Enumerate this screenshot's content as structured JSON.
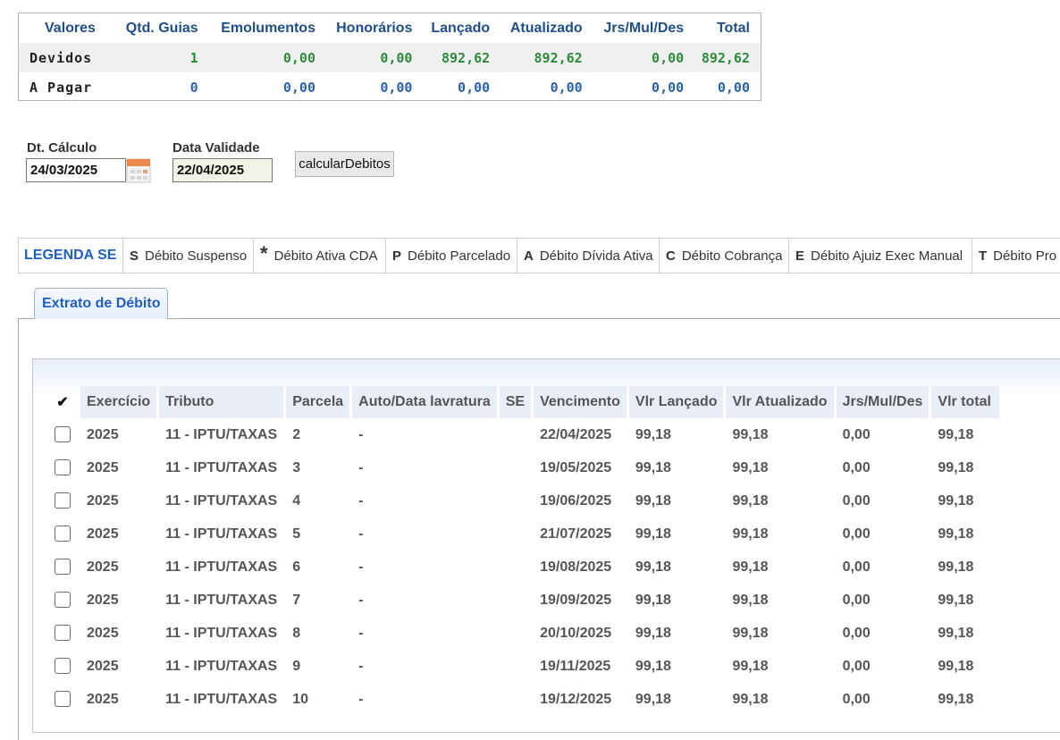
{
  "summary": {
    "headers": [
      "Valores",
      "Qtd. Guias",
      "Emolumentos",
      "Honorários",
      "Lançado",
      "Atualizado",
      "Jrs/Mul/Des",
      "Total"
    ],
    "rows": [
      {
        "label": "Devidos",
        "qtd": "1",
        "emolumentos": "0,00",
        "honorarios": "0,00",
        "lancado": "892,62",
        "atualizado": "892,62",
        "jrs": "0,00",
        "total": "892,62"
      },
      {
        "label": "A Pagar",
        "qtd": "0",
        "emolumentos": "0,00",
        "honorarios": "0,00",
        "lancado": "0,00",
        "atualizado": "0,00",
        "jrs": "0,00",
        "total": "0,00"
      }
    ]
  },
  "form": {
    "dt_calculo_label": "Dt. Cálculo",
    "dt_calculo_value": "24/03/2025",
    "data_validade_label": "Data Validade",
    "data_validade_value": "22/04/2025",
    "calc_button": "calcularDebitos"
  },
  "legend": {
    "title": "LEGENDA SE",
    "items": [
      {
        "code": "S",
        "label": "Débito Suspenso"
      },
      {
        "code": "*",
        "label": "Débito Ativa CDA"
      },
      {
        "code": "P",
        "label": "Débito Parcelado"
      },
      {
        "code": "A",
        "label": "Débito Dívida Ativa"
      },
      {
        "code": "C",
        "label": "Débito Cobrança"
      },
      {
        "code": "E",
        "label": "Débito Ajuiz Exec Manual"
      },
      {
        "code": "T",
        "label": "Débito Pro"
      }
    ]
  },
  "tabs": [
    {
      "label": "Extrato de Débito",
      "active": true
    }
  ],
  "grid": {
    "check_header": "✔",
    "columns": [
      "Exercício",
      "Tributo",
      "Parcela",
      "Auto/Data lavratura",
      "SE",
      "Vencimento",
      "Vlr Lançado",
      "Vlr Atualizado",
      "Jrs/Mul/Des",
      "Vlr total"
    ],
    "rows": [
      [
        "2025",
        "11 - IPTU/TAXAS",
        "2",
        "-",
        "",
        "22/04/2025",
        "99,18",
        "99,18",
        "0,00",
        "99,18"
      ],
      [
        "2025",
        "11 - IPTU/TAXAS",
        "3",
        "-",
        "",
        "19/05/2025",
        "99,18",
        "99,18",
        "0,00",
        "99,18"
      ],
      [
        "2025",
        "11 - IPTU/TAXAS",
        "4",
        "-",
        "",
        "19/06/2025",
        "99,18",
        "99,18",
        "0,00",
        "99,18"
      ],
      [
        "2025",
        "11 - IPTU/TAXAS",
        "5",
        "-",
        "",
        "21/07/2025",
        "99,18",
        "99,18",
        "0,00",
        "99,18"
      ],
      [
        "2025",
        "11 - IPTU/TAXAS",
        "6",
        "-",
        "",
        "19/08/2025",
        "99,18",
        "99,18",
        "0,00",
        "99,18"
      ],
      [
        "2025",
        "11 - IPTU/TAXAS",
        "7",
        "-",
        "",
        "19/09/2025",
        "99,18",
        "99,18",
        "0,00",
        "99,18"
      ],
      [
        "2025",
        "11 - IPTU/TAXAS",
        "8",
        "-",
        "",
        "20/10/2025",
        "99,18",
        "99,18",
        "0,00",
        "99,18"
      ],
      [
        "2025",
        "11 - IPTU/TAXAS",
        "9",
        "-",
        "",
        "19/11/2025",
        "99,18",
        "99,18",
        "0,00",
        "99,18"
      ],
      [
        "2025",
        "11 - IPTU/TAXAS",
        "10",
        "-",
        "",
        "19/12/2025",
        "99,18",
        "99,18",
        "0,00",
        "99,18"
      ]
    ]
  },
  "colors": {
    "header_blue": "#1f4e8c",
    "green_value": "#2e8b3a",
    "blue_value": "#2a62ad",
    "legend_title": "#1f5fbf"
  }
}
